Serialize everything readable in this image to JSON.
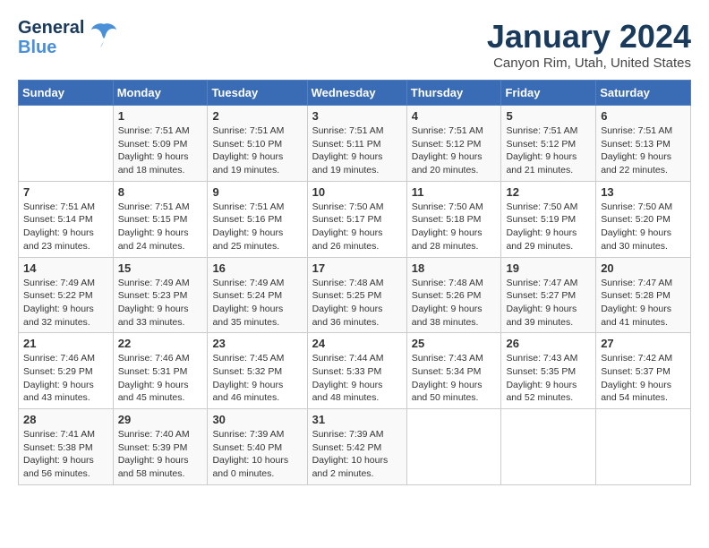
{
  "header": {
    "logo_line1": "General",
    "logo_line2": "Blue",
    "title": "January 2024",
    "subtitle": "Canyon Rim, Utah, United States"
  },
  "days_of_week": [
    "Sunday",
    "Monday",
    "Tuesday",
    "Wednesday",
    "Thursday",
    "Friday",
    "Saturday"
  ],
  "weeks": [
    [
      {
        "day": "",
        "info": ""
      },
      {
        "day": "1",
        "info": "Sunrise: 7:51 AM\nSunset: 5:09 PM\nDaylight: 9 hours\nand 18 minutes."
      },
      {
        "day": "2",
        "info": "Sunrise: 7:51 AM\nSunset: 5:10 PM\nDaylight: 9 hours\nand 19 minutes."
      },
      {
        "day": "3",
        "info": "Sunrise: 7:51 AM\nSunset: 5:11 PM\nDaylight: 9 hours\nand 19 minutes."
      },
      {
        "day": "4",
        "info": "Sunrise: 7:51 AM\nSunset: 5:12 PM\nDaylight: 9 hours\nand 20 minutes."
      },
      {
        "day": "5",
        "info": "Sunrise: 7:51 AM\nSunset: 5:12 PM\nDaylight: 9 hours\nand 21 minutes."
      },
      {
        "day": "6",
        "info": "Sunrise: 7:51 AM\nSunset: 5:13 PM\nDaylight: 9 hours\nand 22 minutes."
      }
    ],
    [
      {
        "day": "7",
        "info": "Sunrise: 7:51 AM\nSunset: 5:14 PM\nDaylight: 9 hours\nand 23 minutes."
      },
      {
        "day": "8",
        "info": "Sunrise: 7:51 AM\nSunset: 5:15 PM\nDaylight: 9 hours\nand 24 minutes."
      },
      {
        "day": "9",
        "info": "Sunrise: 7:51 AM\nSunset: 5:16 PM\nDaylight: 9 hours\nand 25 minutes."
      },
      {
        "day": "10",
        "info": "Sunrise: 7:50 AM\nSunset: 5:17 PM\nDaylight: 9 hours\nand 26 minutes."
      },
      {
        "day": "11",
        "info": "Sunrise: 7:50 AM\nSunset: 5:18 PM\nDaylight: 9 hours\nand 28 minutes."
      },
      {
        "day": "12",
        "info": "Sunrise: 7:50 AM\nSunset: 5:19 PM\nDaylight: 9 hours\nand 29 minutes."
      },
      {
        "day": "13",
        "info": "Sunrise: 7:50 AM\nSunset: 5:20 PM\nDaylight: 9 hours\nand 30 minutes."
      }
    ],
    [
      {
        "day": "14",
        "info": "Sunrise: 7:49 AM\nSunset: 5:22 PM\nDaylight: 9 hours\nand 32 minutes."
      },
      {
        "day": "15",
        "info": "Sunrise: 7:49 AM\nSunset: 5:23 PM\nDaylight: 9 hours\nand 33 minutes."
      },
      {
        "day": "16",
        "info": "Sunrise: 7:49 AM\nSunset: 5:24 PM\nDaylight: 9 hours\nand 35 minutes."
      },
      {
        "day": "17",
        "info": "Sunrise: 7:48 AM\nSunset: 5:25 PM\nDaylight: 9 hours\nand 36 minutes."
      },
      {
        "day": "18",
        "info": "Sunrise: 7:48 AM\nSunset: 5:26 PM\nDaylight: 9 hours\nand 38 minutes."
      },
      {
        "day": "19",
        "info": "Sunrise: 7:47 AM\nSunset: 5:27 PM\nDaylight: 9 hours\nand 39 minutes."
      },
      {
        "day": "20",
        "info": "Sunrise: 7:47 AM\nSunset: 5:28 PM\nDaylight: 9 hours\nand 41 minutes."
      }
    ],
    [
      {
        "day": "21",
        "info": "Sunrise: 7:46 AM\nSunset: 5:29 PM\nDaylight: 9 hours\nand 43 minutes."
      },
      {
        "day": "22",
        "info": "Sunrise: 7:46 AM\nSunset: 5:31 PM\nDaylight: 9 hours\nand 45 minutes."
      },
      {
        "day": "23",
        "info": "Sunrise: 7:45 AM\nSunset: 5:32 PM\nDaylight: 9 hours\nand 46 minutes."
      },
      {
        "day": "24",
        "info": "Sunrise: 7:44 AM\nSunset: 5:33 PM\nDaylight: 9 hours\nand 48 minutes."
      },
      {
        "day": "25",
        "info": "Sunrise: 7:43 AM\nSunset: 5:34 PM\nDaylight: 9 hours\nand 50 minutes."
      },
      {
        "day": "26",
        "info": "Sunrise: 7:43 AM\nSunset: 5:35 PM\nDaylight: 9 hours\nand 52 minutes."
      },
      {
        "day": "27",
        "info": "Sunrise: 7:42 AM\nSunset: 5:37 PM\nDaylight: 9 hours\nand 54 minutes."
      }
    ],
    [
      {
        "day": "28",
        "info": "Sunrise: 7:41 AM\nSunset: 5:38 PM\nDaylight: 9 hours\nand 56 minutes."
      },
      {
        "day": "29",
        "info": "Sunrise: 7:40 AM\nSunset: 5:39 PM\nDaylight: 9 hours\nand 58 minutes."
      },
      {
        "day": "30",
        "info": "Sunrise: 7:39 AM\nSunset: 5:40 PM\nDaylight: 10 hours\nand 0 minutes."
      },
      {
        "day": "31",
        "info": "Sunrise: 7:39 AM\nSunset: 5:42 PM\nDaylight: 10 hours\nand 2 minutes."
      },
      {
        "day": "",
        "info": ""
      },
      {
        "day": "",
        "info": ""
      },
      {
        "day": "",
        "info": ""
      }
    ]
  ]
}
